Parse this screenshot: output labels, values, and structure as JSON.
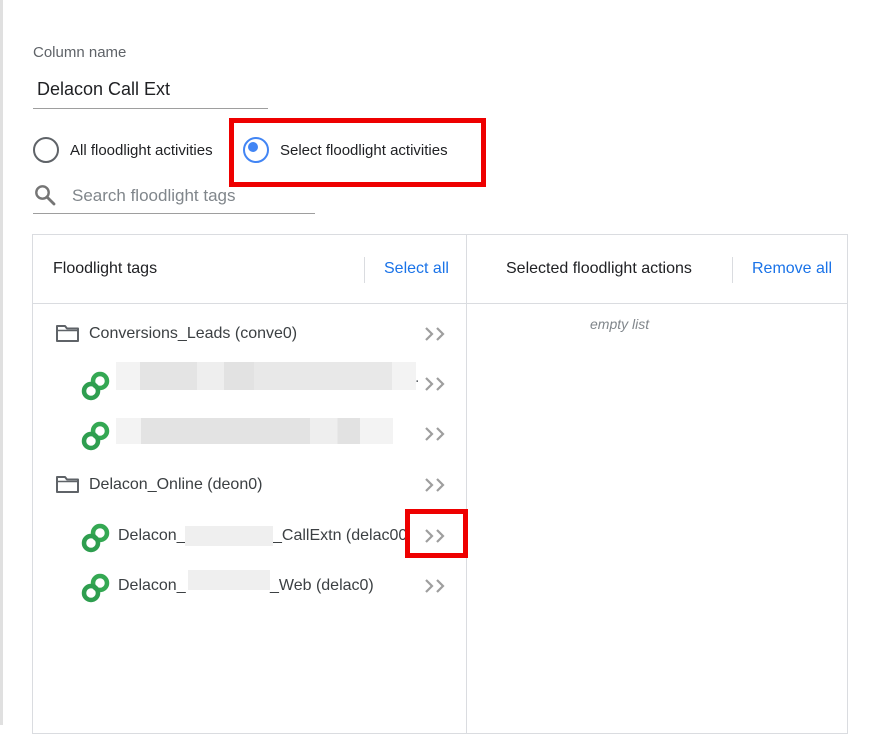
{
  "form": {
    "column_label": "Column name",
    "column_value": "Delacon Call Ext",
    "radio_all": "All floodlight activities",
    "radio_select": "Select floodlight activities",
    "selected_option": "select",
    "search_placeholder": "Search floodlight tags"
  },
  "left_panel": {
    "title": "Floodlight tags",
    "select_all": "Select all",
    "groups": [
      {
        "label": "Conversions_Leads (conve0)",
        "items": [
          {
            "label": ""
          },
          {
            "label": ""
          }
        ]
      },
      {
        "label": "Delacon_Online (deon0)",
        "items": [
          {
            "label_start": "Delacon_",
            "label_end": "_CallExtn (delac00"
          },
          {
            "label_start": "Delacon_",
            "label_end": "_Web (delac0)"
          }
        ]
      }
    ],
    "trailing_dot": "."
  },
  "right_panel": {
    "title": "Selected floodlight actions",
    "remove_all": "Remove all",
    "empty_text": "empty list"
  },
  "colors": {
    "accent_blue": "#1a73e8",
    "radio_blue": "#4285f4",
    "highlight_red": "#ee0000",
    "floodlight_green": "#34a853"
  },
  "icons": {
    "search": "search-icon",
    "folder": "folder-icon",
    "floodlight": "floodlight-tag-icon",
    "move": "double-chevron-right-icon"
  }
}
